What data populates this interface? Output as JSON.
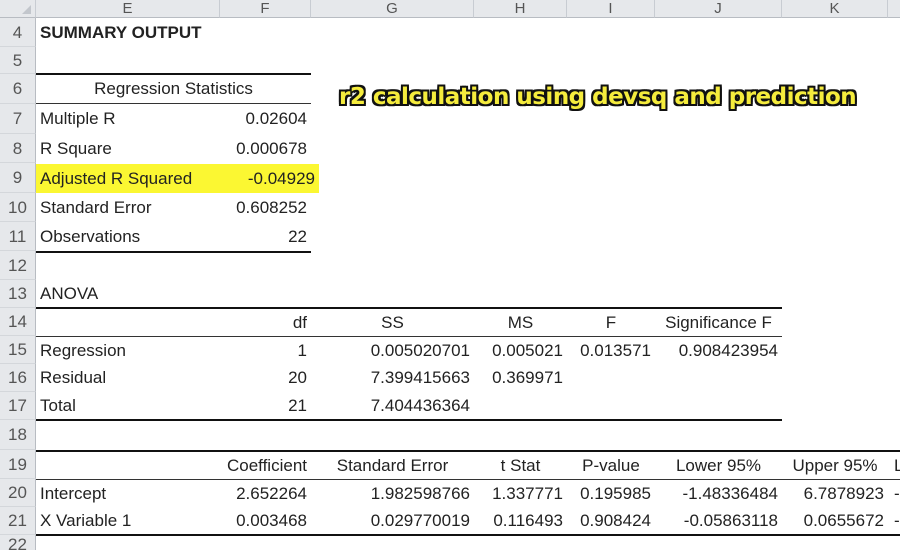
{
  "overlay_title": "r2 calculation using devsq and prediction",
  "highlight_color": "#fbf732",
  "columns": [
    "E",
    "F",
    "G",
    "H",
    "I",
    "J",
    "K"
  ],
  "rows": [
    "4",
    "5",
    "6",
    "7",
    "8",
    "9",
    "10",
    "11",
    "12",
    "13",
    "14",
    "15",
    "16",
    "17",
    "18",
    "19",
    "20",
    "21",
    "22"
  ],
  "summary": {
    "title": "SUMMARY OUTPUT",
    "regression_stats_header": "Regression Statistics",
    "stats": [
      {
        "label": "Multiple R",
        "value": "0.02604"
      },
      {
        "label": "R Square",
        "value": "0.000678"
      },
      {
        "label": "Adjusted R Squared",
        "value": "-0.04929",
        "highlighted": true
      },
      {
        "label": "Standard Error",
        "value": "0.608252"
      },
      {
        "label": "Observations",
        "value": "22"
      }
    ]
  },
  "anova": {
    "title": "ANOVA",
    "headers": [
      "",
      "df",
      "SS",
      "MS",
      "F",
      "Significance F"
    ],
    "rows": [
      [
        "Regression",
        "1",
        "0.005020701",
        "0.005021",
        "0.013571",
        "0.908423954"
      ],
      [
        "Residual",
        "20",
        "7.399415663",
        "0.369971",
        "",
        ""
      ],
      [
        "Total",
        "21",
        "7.404436364",
        "",
        "",
        ""
      ]
    ]
  },
  "coefficients": {
    "headers": [
      "",
      "Coefficient",
      "Standard Error",
      "t Stat",
      "P-value",
      "Lower 95%",
      "Upper 95%",
      "L"
    ],
    "rows": [
      [
        "Intercept",
        "2.652264",
        "1.982598766",
        "1.337771",
        "0.195985",
        "-1.48336484",
        "6.7878923",
        "-"
      ],
      [
        "X Variable 1",
        "0.003468",
        "0.029770019",
        "0.116493",
        "0.908424",
        "-0.05863118",
        "0.0655672",
        "-"
      ]
    ]
  }
}
